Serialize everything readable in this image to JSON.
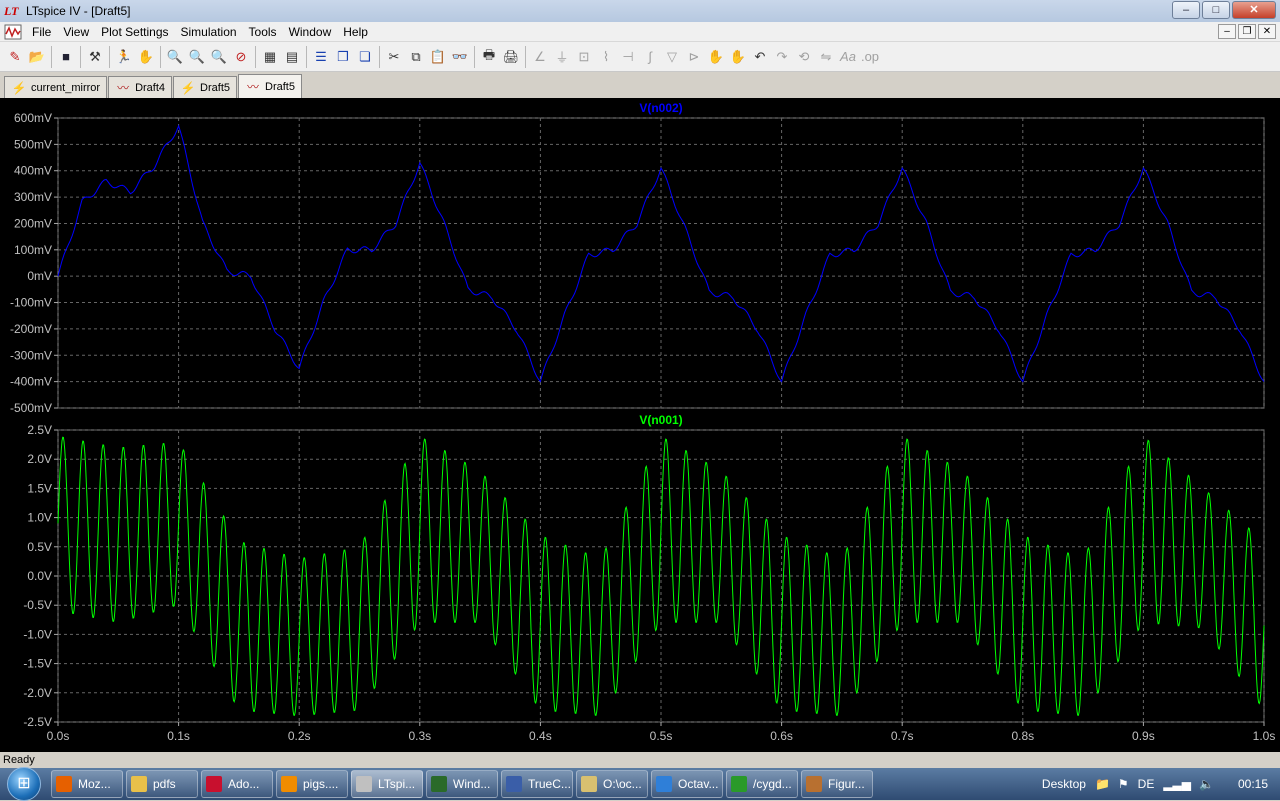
{
  "window": {
    "title": "LTspice IV - [Draft5]",
    "min": "–",
    "max": "□",
    "close": "✕"
  },
  "menu": [
    "File",
    "View",
    "Plot Settings",
    "Simulation",
    "Tools",
    "Window",
    "Help"
  ],
  "mdi": {
    "min": "–",
    "restore": "❐",
    "close": "✕"
  },
  "toolbar": {
    "icons": [
      "new-schematic-icon",
      "open-icon",
      "save-icon",
      "control-panel-icon",
      "run-icon",
      "pan-icon",
      "zoom-in-icon",
      "zoom-area-icon",
      "zoom-out-icon",
      "zoom-cancel-icon",
      "autorange-icon",
      "vertical-autorange-icon",
      "plot-pane-icon",
      "tile-icon",
      "cascade-icon",
      "cut-icon",
      "copy-icon",
      "paste-icon",
      "find-icon",
      "print-preview-icon",
      "print-icon",
      "wire-icon",
      "ground-icon",
      "label-icon",
      "resistor-icon",
      "capacitor-icon",
      "inductor-icon",
      "diode-icon",
      "component-icon",
      "move-icon",
      "drag-icon",
      "undo-icon",
      "redo-icon",
      "rotate-icon",
      "mirror-icon",
      "text-icon",
      "spice-directive-icon"
    ]
  },
  "tabs": [
    {
      "label": "current_mirror",
      "kind": "schematic",
      "active": false
    },
    {
      "label": "Draft4",
      "kind": "waveform",
      "active": false
    },
    {
      "label": "Draft5",
      "kind": "schematic",
      "active": false
    },
    {
      "label": "Draft5",
      "kind": "waveform",
      "active": true
    }
  ],
  "chart_data": [
    {
      "type": "line",
      "title": "V(n002)",
      "color": "#0000ff",
      "ylim": [
        -500,
        600
      ],
      "yunit": "mV",
      "yticks": [
        600,
        500,
        400,
        300,
        200,
        100,
        0,
        -100,
        -200,
        -300,
        -400,
        -500
      ],
      "ytick_labels": [
        "600mV",
        "500mV",
        "400mV",
        "300mV",
        "200mV",
        "100mV",
        "0mV",
        "-100mV",
        "-200mV",
        "-300mV",
        "-400mV",
        "-500mV"
      ],
      "xlim": [
        0,
        1.0
      ],
      "grid": true,
      "series": [
        {
          "name": "V(n002)",
          "x": [
            0,
            0.02,
            0.04,
            0.06,
            0.08,
            0.1,
            0.12,
            0.14,
            0.16,
            0.18,
            0.2,
            0.22,
            0.24,
            0.26,
            0.28,
            0.3,
            0.32,
            0.34,
            0.36,
            0.38,
            0.4,
            0.42,
            0.44,
            0.46,
            0.48,
            0.5,
            0.52,
            0.54,
            0.56,
            0.58,
            0.6,
            0.62,
            0.64,
            0.66,
            0.68,
            0.7,
            0.72,
            0.74,
            0.76,
            0.78,
            0.8,
            0.82,
            0.84,
            0.86,
            0.88,
            0.9,
            0.92,
            0.94,
            0.96,
            0.98,
            1.0
          ],
          "y": [
            0,
            280,
            360,
            320,
            420,
            570,
            200,
            20,
            0,
            -200,
            -350,
            -100,
            100,
            100,
            200,
            430,
            200,
            -50,
            -80,
            -200,
            -400,
            -150,
            80,
            100,
            200,
            410,
            180,
            -60,
            -80,
            -200,
            -400,
            -150,
            80,
            100,
            200,
            410,
            200,
            -60,
            -80,
            -200,
            -400,
            -150,
            80,
            100,
            200,
            410,
            200,
            -60,
            -80,
            -200,
            -400
          ]
        }
      ]
    },
    {
      "type": "line",
      "title": "V(n001)",
      "color": "#00ff00",
      "ylim": [
        -2.5,
        2.5
      ],
      "yunit": "V",
      "yticks": [
        2.5,
        2.0,
        1.5,
        1.0,
        0.5,
        0.0,
        -0.5,
        -1.0,
        -1.5,
        -2.0,
        -2.5
      ],
      "ytick_labels": [
        "2.5V",
        "2.0V",
        "1.5V",
        "1.0V",
        "0.5V",
        "0.0V",
        "-0.5V",
        "-1.0V",
        "-1.5V",
        "-2.0V",
        "-2.5V"
      ],
      "xlim": [
        0,
        1.0
      ],
      "xticks": [
        0,
        0.1,
        0.2,
        0.3,
        0.4,
        0.5,
        0.6,
        0.7,
        0.8,
        0.9,
        1.0
      ],
      "xtick_labels": [
        "0.0s",
        "0.1s",
        "0.2s",
        "0.3s",
        "0.4s",
        "0.5s",
        "0.6s",
        "0.7s",
        "0.8s",
        "0.9s",
        "1.0s"
      ],
      "grid": true,
      "series": [
        {
          "name": "V(n001)",
          "x": [
            0,
            0.05,
            0.1,
            0.15,
            0.2,
            0.25,
            0.3,
            0.35,
            0.4,
            0.45,
            0.5,
            0.55,
            0.6,
            0.65,
            0.7,
            0.75,
            0.8,
            0.85,
            0.9,
            0.95,
            1.0
          ],
          "upper": [
            2.4,
            2.2,
            2.3,
            0.6,
            0.3,
            0.5,
            2.4,
            1.8,
            0.7,
            0.3,
            2.4,
            1.8,
            0.7,
            0.3,
            2.4,
            1.8,
            0.7,
            0.3,
            2.4,
            1.5,
            0.6
          ],
          "lower": [
            -0.6,
            -0.8,
            -0.5,
            -2.3,
            -2.4,
            -2.3,
            -0.8,
            -0.8,
            -2.3,
            -2.4,
            -0.8,
            -0.8,
            -2.3,
            -2.4,
            -0.8,
            -0.8,
            -2.3,
            -2.4,
            -0.8,
            -0.9,
            -2.3
          ],
          "cycles_per_second": 60
        }
      ]
    }
  ],
  "status": "Ready",
  "taskbar": {
    "start": "⊞",
    "items": [
      {
        "label": "Moz...",
        "icon_color": "#e66000"
      },
      {
        "label": "pdfs",
        "icon_color": "#e8c04a"
      },
      {
        "label": "Ado...",
        "icon_color": "#c8102e"
      },
      {
        "label": "pigs....",
        "icon_color": "#f08c00"
      },
      {
        "label": "LTspi...",
        "icon_color": "#c0c0c0",
        "active": true
      },
      {
        "label": "Wind...",
        "icon_color": "#2a6a2a"
      },
      {
        "label": "TrueC...",
        "icon_color": "#3a5ea8"
      },
      {
        "label": "O:\\oc...",
        "icon_color": "#d8c070"
      },
      {
        "label": "Octav...",
        "icon_color": "#2f7fd8"
      },
      {
        "label": "/cygd...",
        "icon_color": "#2a9a2a"
      },
      {
        "label": "Figur...",
        "icon_color": "#b87030"
      }
    ],
    "tray": {
      "desktop": "Desktop",
      "lang": "DE",
      "time": "00:15"
    }
  }
}
